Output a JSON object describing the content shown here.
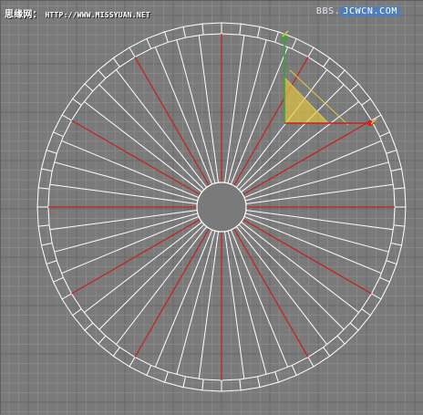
{
  "viewport": {
    "watermark_left_cn": "思缘网：",
    "watermark_left_url": "HTTP://WWW.MISSYUAN.NET",
    "watermark_right_a": "BBS.",
    "watermark_right_b": "JCWCN.COM"
  },
  "scene": {
    "wheel_outer_segments": 60,
    "spoke_count": 48,
    "red_spoke_every": 4,
    "colors": {
      "background": "#7a7a7a",
      "grid_minor": "#8b8b8b",
      "grid_major": "#686868",
      "wireframe": "#ffffff",
      "highlight_spoke": "#c81e1e",
      "gizmo_plane": "#e8c840",
      "gizmo_y_axis": "#3aa33a",
      "gizmo_x_axis": "#d02020"
    }
  }
}
